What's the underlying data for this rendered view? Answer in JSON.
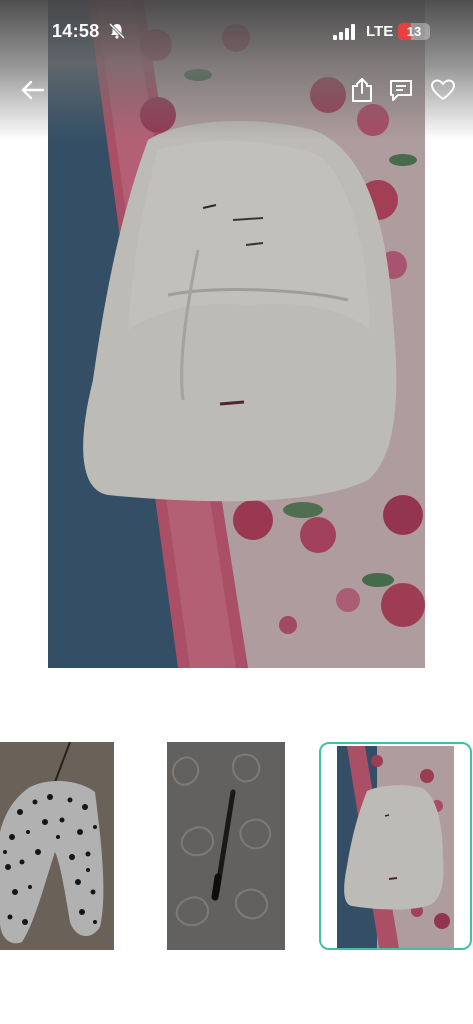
{
  "status_bar": {
    "time": "14:58",
    "network": "LTE",
    "battery_level": "13",
    "icons": [
      "bell-muted-icon",
      "signal-icon"
    ]
  },
  "header": {
    "icons": [
      "back-arrow-icon",
      "share-icon",
      "message-icon",
      "heart-icon"
    ]
  },
  "gallery": {
    "selected_index": 2,
    "thumbnail_count": 3,
    "selection_color": "#3fc2a2"
  }
}
